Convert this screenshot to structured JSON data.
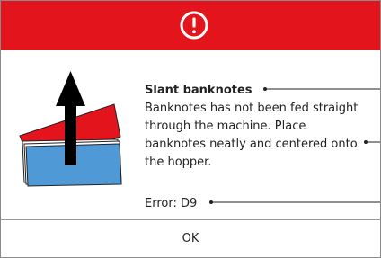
{
  "dialog": {
    "header_color": "#e3141b",
    "icon": "exclamation-circle-icon",
    "illustration": "banknote-slant-illustration",
    "title": "Slant banknotes",
    "message": "Banknotes has not been fed straight through the machine. Place banknotes neatly and centered onto the hopper.",
    "error": "Error: D9",
    "ok_label": "OK"
  }
}
